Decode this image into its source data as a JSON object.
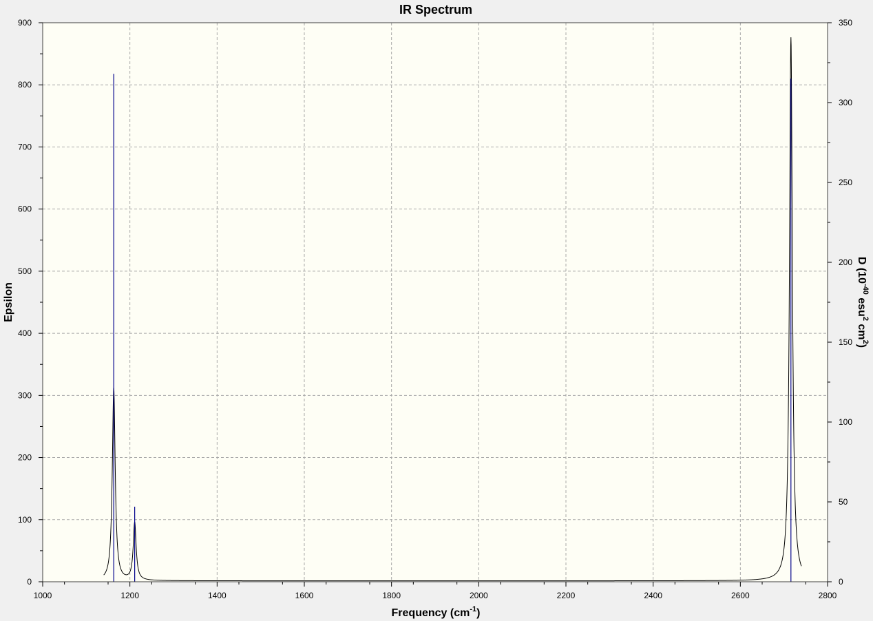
{
  "chart_data": {
    "type": "line",
    "title": "IR Spectrum",
    "xlabel": "Frequency (cm",
    "xlabel_sup": "-1",
    "xlabel_tail": ")",
    "ylabel_left": "Epsilon",
    "ylabel_right": "D (10",
    "ylabel_right_sup1": "-40",
    "ylabel_right_mid": " esu",
    "ylabel_right_sup2": "2",
    "ylabel_right_mid2": " cm",
    "ylabel_right_sup3": "2",
    "ylabel_right_tail": ")",
    "xlim": [
      1000,
      2800
    ],
    "ylim_left": [
      0,
      900
    ],
    "ylim_right": [
      0,
      350
    ],
    "x_ticks": [
      1000,
      1200,
      1400,
      1600,
      1800,
      2000,
      2200,
      2400,
      2600,
      2800
    ],
    "y_left_ticks": [
      0,
      100,
      200,
      300,
      400,
      500,
      600,
      700,
      800,
      900
    ],
    "y_right_ticks": [
      0,
      50,
      100,
      150,
      200,
      250,
      300,
      350
    ],
    "grid": true,
    "colors": {
      "plot_background": "#fefef5",
      "page_background": "#f0f0f0",
      "spectrum_line": "#000000",
      "stick_line": "#00008b",
      "grid_line": "#a8a8a8"
    },
    "series": [
      {
        "kind": "spectrum",
        "axis": "left",
        "x_range": [
          1140,
          2740
        ],
        "peaks": [
          {
            "center": 1163,
            "height": 310
          },
          {
            "center": 1211,
            "height": 93
          },
          {
            "center": 2716,
            "height": 875
          }
        ],
        "baseline": 1.5
      },
      {
        "kind": "sticks",
        "axis": "right",
        "x": [
          1163,
          1211,
          2716
        ],
        "values": [
          318,
          47,
          315
        ]
      }
    ]
  }
}
